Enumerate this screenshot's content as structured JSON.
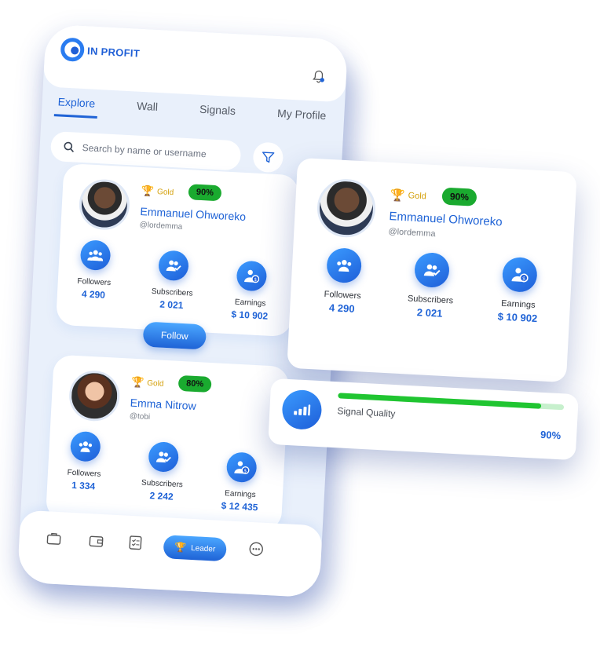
{
  "app": {
    "brand": "IN PROFIT"
  },
  "tabs": [
    {
      "label": "Explore",
      "active": true
    },
    {
      "label": "Wall",
      "active": false
    },
    {
      "label": "Signals",
      "active": false
    },
    {
      "label": "My Profile",
      "active": false
    }
  ],
  "search": {
    "placeholder": "Search by name or username"
  },
  "profiles": [
    {
      "tier": "Gold",
      "percent": "90%",
      "name": "Emmanuel Ohworeko",
      "handle": "@lordemma",
      "stats": [
        {
          "label": "Followers",
          "value": "4 290"
        },
        {
          "label": "Subscribers",
          "value": "2 021"
        },
        {
          "label": "Earnings",
          "value": "$ 10 902"
        }
      ],
      "action": "Follow"
    },
    {
      "tier": "Gold",
      "percent": "80%",
      "name": "Emma Nitrow",
      "handle": "@tobi",
      "stats": [
        {
          "label": "Followers",
          "value": "1 334"
        },
        {
          "label": "Subscribers",
          "value": "2 242"
        },
        {
          "label": "Earnings",
          "value": "$ 12 435"
        }
      ]
    }
  ],
  "floating_profile": {
    "tier": "Gold",
    "percent": "90%",
    "name": "Emmanuel Ohworeko",
    "handle": "@lordemma",
    "stats": [
      {
        "label": "Followers",
        "value": "4 290"
      },
      {
        "label": "Subscribers",
        "value": "2 021"
      },
      {
        "label": "Earnings",
        "value": "$ 10 902"
      }
    ]
  },
  "signal": {
    "label": "Signal Quality",
    "value": "90%",
    "level": 0.9
  },
  "nav": {
    "leader_label": "Leader"
  },
  "colors": {
    "accent": "#1f63d6",
    "success": "#20c531",
    "gold": "#d4a00a"
  }
}
